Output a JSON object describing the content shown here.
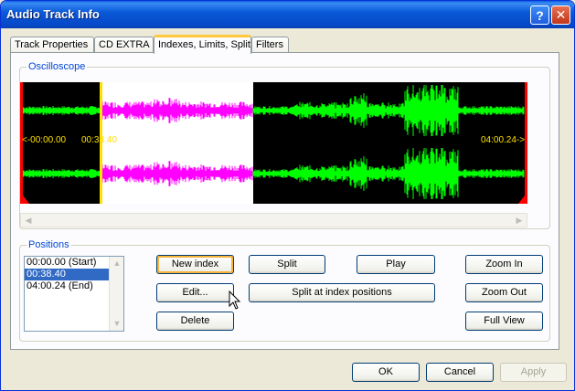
{
  "window": {
    "title": "Audio Track Info",
    "help_label": "?",
    "close_label": "✕"
  },
  "tabs": [
    {
      "label": "Track Properties",
      "active": false
    },
    {
      "label": "CD EXTRA",
      "active": false
    },
    {
      "label": "Indexes, Limits, Split",
      "active": true
    },
    {
      "label": "Filters",
      "active": false
    }
  ],
  "oscilloscope": {
    "group_label": "Oscilloscope",
    "start_label": "<-00:00.00",
    "cursor_label": "00:38.40",
    "end_label": "04:00.24->",
    "colors": {
      "wave": "#00ff00",
      "selected_wave": "#ff00ff",
      "selection_bg": "#ffffff",
      "cursor": "#ffe000",
      "marker": "#ff0000"
    }
  },
  "positions": {
    "group_label": "Positions",
    "items": [
      "00:00.00 (Start)",
      "00:38.40",
      "04:00.24 (End)"
    ],
    "selected_index": 1
  },
  "buttons": {
    "new_index": "New index",
    "edit": "Edit...",
    "delete": "Delete",
    "split": "Split",
    "split_at_index": "Split at index positions",
    "play": "Play",
    "zoom_in": "Zoom In",
    "zoom_out": "Zoom Out",
    "full_view": "Full View"
  },
  "dialog": {
    "ok": "OK",
    "cancel": "Cancel",
    "apply": "Apply"
  }
}
